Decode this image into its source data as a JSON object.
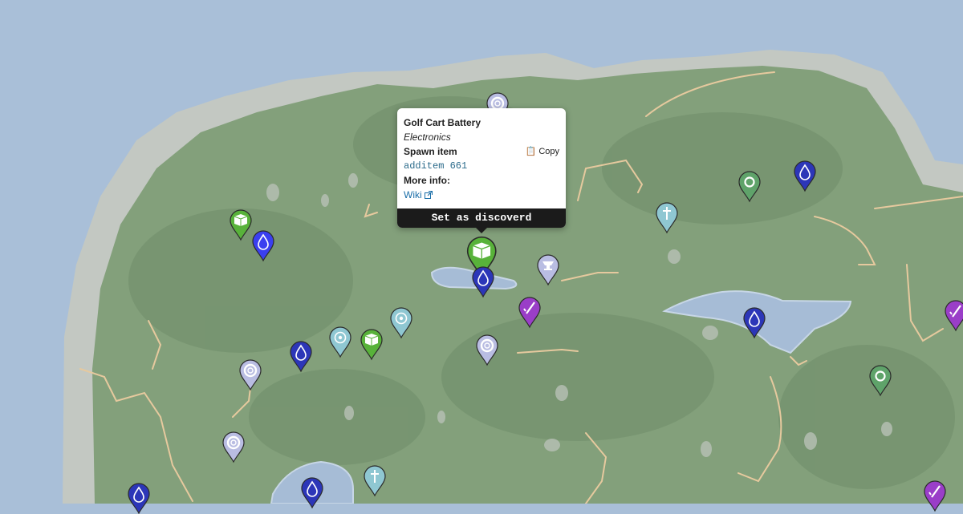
{
  "popup": {
    "title": "Golf Cart Battery",
    "category": "Electronics",
    "spawn_label": "Spawn item",
    "copy_label": "📋 Copy",
    "command": "additem 661",
    "more_info_label": "More info:",
    "wiki_label": "Wiki",
    "wiki_icon": "external-link-icon",
    "discover_button": "Set as discoverd"
  },
  "colors": {
    "water": "#a9bfd8",
    "land": "#83a07b",
    "shore": "#c3c8c2",
    "road": "#e6c99e",
    "lake": "#a6bcd6",
    "water_marker": "#2c36b8",
    "water_marker_bright": "#3a3ff0",
    "cave_marker": "#5fa36a",
    "electronics_marker": "#58b23a",
    "totem_marker": "#8fc7d2",
    "loot_marker": "#b9bde2",
    "weapon_marker": "#9a3ec8"
  },
  "markers": [
    {
      "kind": "loot",
      "icon": "life-ring-icon"
    },
    {
      "kind": "electronics",
      "icon": "battery-icon",
      "selected": true
    },
    {
      "kind": "water",
      "icon": "water-drop-icon"
    },
    {
      "kind": "loot",
      "icon": "anvil-icon"
    },
    {
      "kind": "weapon",
      "icon": "rifle-icon"
    },
    {
      "kind": "electronics",
      "icon": "battery-icon"
    },
    {
      "kind": "water_bright",
      "icon": "water-drop-icon"
    },
    {
      "kind": "totem",
      "icon": "cross-icon"
    },
    {
      "kind": "cave",
      "icon": "ring-icon"
    },
    {
      "kind": "water",
      "icon": "water-drop-icon"
    },
    {
      "kind": "totem",
      "icon": "target-icon"
    },
    {
      "kind": "totem",
      "icon": "target-icon"
    },
    {
      "kind": "electronics",
      "icon": "battery-icon"
    },
    {
      "kind": "water",
      "icon": "water-drop-icon"
    },
    {
      "kind": "loot",
      "icon": "life-ring-icon"
    },
    {
      "kind": "loot",
      "icon": "life-ring-icon"
    },
    {
      "kind": "water",
      "icon": "water-drop-icon"
    },
    {
      "kind": "weapon",
      "icon": "rifle-icon"
    },
    {
      "kind": "cave",
      "icon": "ring-icon"
    },
    {
      "kind": "loot",
      "icon": "life-ring-icon"
    },
    {
      "kind": "water",
      "icon": "water-drop-icon"
    },
    {
      "kind": "water",
      "icon": "water-drop-icon"
    },
    {
      "kind": "totem",
      "icon": "cross-icon"
    },
    {
      "kind": "weapon",
      "icon": "rifle-icon"
    }
  ]
}
